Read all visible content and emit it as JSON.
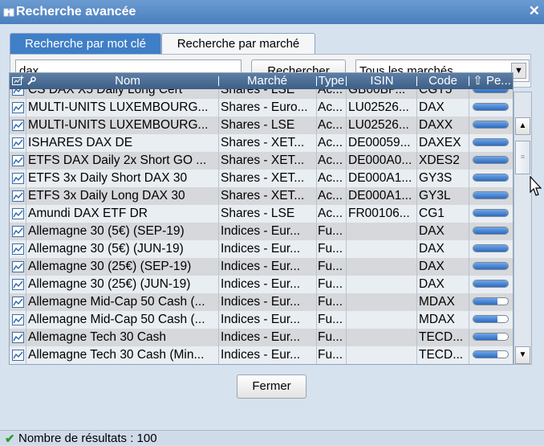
{
  "window": {
    "title": "Recherche avancée",
    "close_glyph": "✕"
  },
  "tabs": [
    {
      "label": "Recherche par mot clé",
      "active": true
    },
    {
      "label": "Recherche par marché",
      "active": false
    }
  ],
  "search": {
    "value": "dax",
    "button_label": "Rechercher"
  },
  "market_select": {
    "value": "Tous les marchés"
  },
  "grid": {
    "header_icons": [
      "add-to-list-icon",
      "wrench-icon"
    ],
    "columns": [
      "Nom",
      "Marché",
      "Type",
      "ISIN",
      "Code",
      "Pe..."
    ],
    "rows": [
      {
        "name": "CS DAX X5 Daily Long Cert",
        "market": "Shares - LSE",
        "type": "Ac...",
        "isin": "GB00BP...",
        "code": "CGT5",
        "bar": 1.0
      },
      {
        "name": "MULTI-UNITS LUXEMBOURG...",
        "market": "Shares - Euro...",
        "type": "Ac...",
        "isin": "LU02526...",
        "code": "DAX",
        "bar": 1.0
      },
      {
        "name": "MULTI-UNITS LUXEMBOURG...",
        "market": "Shares - LSE",
        "type": "Ac...",
        "isin": "LU02526...",
        "code": "DAXX",
        "bar": 1.0
      },
      {
        "name": "ISHARES DAX DE",
        "market": "Shares - XET...",
        "type": "Ac...",
        "isin": "DE00059...",
        "code": "DAXEX",
        "bar": 1.0
      },
      {
        "name": "ETFS DAX Daily 2x Short GO ...",
        "market": "Shares - XET...",
        "type": "Ac...",
        "isin": "DE000A0...",
        "code": "XDES2",
        "bar": 1.0
      },
      {
        "name": "ETFS 3x Daily Short DAX 30",
        "market": "Shares - XET...",
        "type": "Ac...",
        "isin": "DE000A1...",
        "code": "GY3S",
        "bar": 1.0
      },
      {
        "name": "ETFS 3x Daily Long DAX 30",
        "market": "Shares - XET...",
        "type": "Ac...",
        "isin": "DE000A1...",
        "code": "GY3L",
        "bar": 1.0
      },
      {
        "name": "Amundi DAX ETF DR",
        "market": "Shares - LSE",
        "type": "Ac...",
        "isin": "FR00106...",
        "code": "CG1",
        "bar": 1.0
      },
      {
        "name": "Allemagne 30 (5€) (SEP-19)",
        "market": "Indices - Eur...",
        "type": "Fu...",
        "isin": "",
        "code": "DAX",
        "bar": 1.0
      },
      {
        "name": "Allemagne 30 (5€) (JUN-19)",
        "market": "Indices - Eur...",
        "type": "Fu...",
        "isin": "",
        "code": "DAX",
        "bar": 1.0
      },
      {
        "name": "Allemagne 30 (25€) (SEP-19)",
        "market": "Indices - Eur...",
        "type": "Fu...",
        "isin": "",
        "code": "DAX",
        "bar": 1.0
      },
      {
        "name": "Allemagne 30 (25€) (JUN-19)",
        "market": "Indices - Eur...",
        "type": "Fu...",
        "isin": "",
        "code": "DAX",
        "bar": 1.0
      },
      {
        "name": "Allemagne Mid-Cap 50 Cash (...",
        "market": "Indices - Eur...",
        "type": "Fu...",
        "isin": "",
        "code": "MDAX",
        "bar": 0.7
      },
      {
        "name": "Allemagne Mid-Cap 50 Cash (...",
        "market": "Indices - Eur...",
        "type": "Fu...",
        "isin": "",
        "code": "MDAX",
        "bar": 0.7
      },
      {
        "name": "Allemagne Tech 30 Cash",
        "market": "Indices - Eur...",
        "type": "Fu...",
        "isin": "",
        "code": "TECD...",
        "bar": 0.7
      },
      {
        "name": "Allemagne Tech 30 Cash (Min...",
        "market": "Indices - Eur...",
        "type": "Fu...",
        "isin": "",
        "code": "TECD...",
        "bar": 0.7
      }
    ]
  },
  "close_button": {
    "label": "Fermer"
  },
  "status": {
    "text": "Nombre de résultats : 100"
  },
  "colors": {
    "title_bar": "#4a7fbf",
    "tab_active": "#3f7fc7",
    "grid_header": "#4a6c94",
    "bar_fill": "#3f7fd0"
  }
}
